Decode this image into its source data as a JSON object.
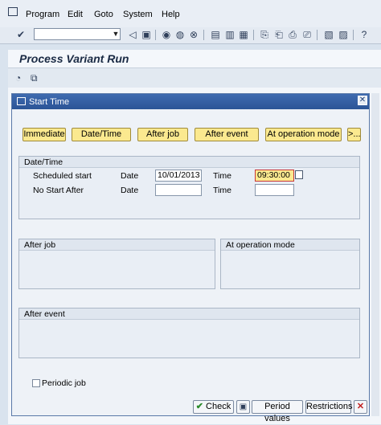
{
  "menu": {
    "items": [
      {
        "label": "Program"
      },
      {
        "label": "Edit"
      },
      {
        "label": "Goto"
      },
      {
        "label": "System"
      },
      {
        "label": "Help"
      }
    ]
  },
  "page": {
    "title": "Process Variant Run"
  },
  "dialog": {
    "title": "Start Time",
    "buttons": {
      "immediate": "Immediate",
      "date_time": "Date/Time",
      "after_job": "After job",
      "after_event": "After event",
      "at_operation_mode": "At operation mode",
      "more": ">..."
    },
    "date_time_group": {
      "label": "Date/Time",
      "scheduled_start_label": "Scheduled start",
      "no_start_after_label": "No Start After",
      "date_label": "Date",
      "time_label": "Time",
      "scheduled_start_date": "10/01/2013",
      "scheduled_start_time": "09:30:00",
      "no_start_after_date": "",
      "no_start_after_time": ""
    },
    "after_job_group": {
      "label": "After job"
    },
    "at_operation_mode_group": {
      "label": "At operation mode"
    },
    "after_event_group": {
      "label": "After event"
    },
    "periodic_job_label": "Periodic job",
    "footer": {
      "check": "Check",
      "period_values": "Period values",
      "restrictions": "Restrictions"
    }
  }
}
